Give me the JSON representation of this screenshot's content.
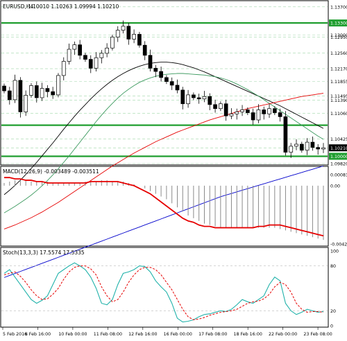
{
  "chart_data": [
    {
      "type": "candlestick",
      "title": "EURUSD,H4",
      "ohlc_readout": "1.10010 1.10263 1.09994 1.10210",
      "ylim": [
        1.0982,
        1.138
      ],
      "y_tick_labels": [
        "1.13700",
        "1.13300",
        "1.13000",
        "1.12950",
        "1.12560",
        "1.12170",
        "1.11855",
        "1.11495",
        "1.11390",
        "1.11060",
        "1.10425",
        "1.10210",
        "1.10000",
        "1.09820"
      ],
      "current_price": "1.10210",
      "horizontal_levels": [
        1.133,
        1.1077,
        1.1
      ],
      "close_values": [
        1.1162,
        1.114,
        1.1188,
        1.111,
        1.1151,
        1.1175,
        1.1145,
        1.1168,
        1.116,
        1.1152,
        1.12,
        1.1235,
        1.1265,
        1.1276,
        1.125,
        1.124,
        1.1218,
        1.1244,
        1.1255,
        1.1268,
        1.1295,
        1.1312,
        1.1322,
        1.129,
        1.1302,
        1.1275,
        1.125,
        1.1218,
        1.121,
        1.1195,
        1.1185,
        1.1176,
        1.1164,
        1.113,
        1.1152,
        1.1145,
        1.1142,
        1.1148,
        1.1128,
        1.1118,
        1.113,
        1.11,
        1.1105,
        1.111,
        1.1115,
        1.1108,
        1.109,
        1.1115,
        1.1105,
        1.1118,
        1.1108,
        1.1098,
        1.101,
        1.1025,
        1.103,
        1.1015,
        1.1035,
        1.1022,
        1.1018,
        1.1021
      ],
      "moving_averages": [
        {
          "color": "#000000",
          "values": [
            1.0905,
            1.0916,
            1.0928,
            1.0941,
            1.0955,
            1.097,
            1.0985,
            1.1001,
            1.1017,
            1.1033,
            1.105,
            1.1067,
            1.1083,
            1.1099,
            1.1114,
            1.1128,
            1.1142,
            1.1155,
            1.1167,
            1.1178,
            1.1188,
            1.1197,
            1.1205,
            1.1212,
            1.1218,
            1.1223,
            1.1227,
            1.123,
            1.1232,
            1.1233,
            1.1233,
            1.1232,
            1.123,
            1.1227,
            1.1223,
            1.1219,
            1.1214,
            1.1209,
            1.1203,
            1.1197,
            1.1191,
            1.1185,
            1.1179,
            1.1173,
            1.1167,
            1.1161,
            1.1155,
            1.1149,
            1.1143,
            1.1137,
            1.1131,
            1.1125,
            1.1118,
            1.1111,
            1.1104,
            1.1097,
            1.109,
            1.1083,
            1.1076,
            1.1069
          ]
        },
        {
          "color": "#3c9a5f",
          "values": [
            1.086,
            1.0868,
            1.0876,
            1.0885,
            1.0894,
            1.0904,
            1.0915,
            1.0927,
            1.094,
            1.0954,
            1.0969,
            1.0985,
            1.1001,
            1.1018,
            1.1035,
            1.1052,
            1.1069,
            1.1086,
            1.1102,
            1.1117,
            1.1131,
            1.1144,
            1.1156,
            1.1166,
            1.1175,
            1.1183,
            1.1189,
            1.1194,
            1.1198,
            1.1201,
            1.1203,
            1.1204,
            1.1205,
            1.1205,
            1.1204,
            1.1203,
            1.1202,
            1.1201,
            1.1199,
            1.1197,
            1.1194,
            1.119,
            1.1185,
            1.1179,
            1.1172,
            1.1165,
            1.1157,
            1.1149,
            1.114,
            1.1131,
            1.1122,
            1.1113,
            1.1104,
            1.1095,
            1.1086,
            1.1077,
            1.1068,
            1.1059,
            1.105,
            1.1042
          ]
        },
        {
          "color": "#e60000",
          "values": [
            1.082,
            1.0825,
            1.083,
            1.0836,
            1.0842,
            1.0848,
            1.0855,
            1.0862,
            1.087,
            1.0878,
            1.0886,
            1.0895,
            1.0904,
            1.0913,
            1.0922,
            1.0931,
            1.094,
            1.0949,
            1.0958,
            1.0967,
            1.0976,
            1.0984,
            1.0992,
            1.1,
            1.1008,
            1.1015,
            1.1022,
            1.1029,
            1.1036,
            1.1042,
            1.1048,
            1.1054,
            1.106,
            1.1065,
            1.107,
            1.1075,
            1.108,
            1.1085,
            1.109,
            1.1094,
            1.1098,
            1.1102,
            1.1106,
            1.111,
            1.1114,
            1.1118,
            1.1121,
            1.1124,
            1.1127,
            1.113,
            1.1133,
            1.1136,
            1.1139,
            1.1142,
            1.1145,
            1.1148,
            1.115,
            1.1152,
            1.1154,
            1.1156
          ]
        },
        {
          "color": "#0000cc",
          "values": [
            1.07,
            1.0705,
            1.071,
            1.0715,
            1.072,
            1.0725,
            1.073,
            1.0735,
            1.074,
            1.0745,
            1.075,
            1.0755,
            1.076,
            1.0765,
            1.077,
            1.0775,
            1.078,
            1.0785,
            1.079,
            1.0795,
            1.08,
            1.0805,
            1.081,
            1.0815,
            1.082,
            1.0825,
            1.083,
            1.0835,
            1.084,
            1.0845,
            1.085,
            1.0855,
            1.086,
            1.0865,
            1.087,
            1.0875,
            1.088,
            1.0885,
            1.089,
            1.0895,
            1.09,
            1.0904,
            1.0908,
            1.0912,
            1.0916,
            1.092,
            1.0924,
            1.0928,
            1.0932,
            1.0936,
            1.094,
            1.0944,
            1.0948,
            1.0952,
            1.0956,
            1.096,
            1.0964,
            1.0968,
            1.0972,
            1.0976
          ]
        }
      ]
    },
    {
      "type": "bar",
      "title": "MACD(12,26,9) -0.003489 -0.003511",
      "ylim": [
        -0.004299,
        0.000813
      ],
      "y_tick_labels": [
        "0.000813",
        "0.00",
        "-0.004299"
      ],
      "histogram_values": [
        0.0002,
        0.0003,
        0.0004,
        0.0004,
        0.0004,
        0.0003,
        0.0003,
        0.0003,
        0.0003,
        0.0002,
        0.0002,
        0.0002,
        0.0002,
        0.0002,
        0.0002,
        0.0003,
        0.0003,
        0.0003,
        0.0004,
        0.0004,
        0.0003,
        0.0003,
        0.0003,
        0.0002,
        0.0001,
        0.0,
        -0.0002,
        -0.0004,
        -0.0006,
        -0.0008,
        -0.001,
        -0.0013,
        -0.0016,
        -0.0019,
        -0.0022,
        -0.0024,
        -0.0026,
        -0.0028,
        -0.0029,
        -0.003,
        -0.0031,
        -0.0031,
        -0.0031,
        -0.0031,
        -0.0031,
        -0.0031,
        -0.0031,
        -0.0031,
        -0.0031,
        -0.0031,
        -0.0031,
        -0.0032,
        -0.0033,
        -0.0034,
        -0.0035,
        -0.0036,
        -0.0037,
        -0.0038,
        -0.0039,
        -0.004
      ],
      "signal_values": [
        0.0006,
        0.0006,
        0.0005,
        0.0005,
        0.0004,
        0.0004,
        0.0003,
        0.0003,
        0.0002,
        0.0002,
        0.0002,
        0.0002,
        0.0002,
        0.0002,
        0.0002,
        0.0002,
        0.0003,
        0.0003,
        0.0003,
        0.0003,
        0.0003,
        0.0003,
        0.0002,
        0.0001,
        0.0,
        -0.0002,
        -0.0004,
        -0.0006,
        -0.0009,
        -0.0012,
        -0.0015,
        -0.0018,
        -0.0021,
        -0.0024,
        -0.0026,
        -0.0027,
        -0.0029,
        -0.003,
        -0.003,
        -0.0031,
        -0.0031,
        -0.0031,
        -0.0031,
        -0.0031,
        -0.0031,
        -0.0031,
        -0.0031,
        -0.003,
        -0.003,
        -0.0029,
        -0.0029,
        -0.0029,
        -0.003,
        -0.0031,
        -0.0032,
        -0.0033,
        -0.0034,
        -0.0035,
        -0.0036,
        -0.0037
      ]
    },
    {
      "type": "line",
      "title": "Stoch(13,3,3) 17.5574 17.5335",
      "ylim": [
        0,
        100
      ],
      "y_tick_labels": [
        "100",
        "80",
        "20",
        "0"
      ],
      "levels": [
        80,
        20
      ],
      "main_values": [
        70,
        75,
        65,
        55,
        45,
        35,
        30,
        34,
        40,
        55,
        70,
        75,
        80,
        84,
        80,
        75,
        65,
        50,
        30,
        28,
        35,
        55,
        70,
        72,
        75,
        80,
        79,
        72,
        60,
        52,
        45,
        30,
        10,
        5,
        6,
        8,
        12,
        15,
        16,
        18,
        20,
        19,
        22,
        28,
        35,
        32,
        30,
        35,
        40,
        55,
        65,
        60,
        30,
        20,
        15,
        18,
        22,
        20,
        18,
        19
      ],
      "signal_values": [
        68,
        70,
        72,
        66,
        58,
        48,
        40,
        35,
        36,
        42,
        50,
        62,
        72,
        78,
        80,
        80,
        76,
        68,
        52,
        40,
        32,
        35,
        45,
        58,
        68,
        75,
        78,
        78,
        75,
        68,
        58,
        48,
        35,
        22,
        12,
        8,
        9,
        11,
        14,
        16,
        18,
        19,
        20,
        22,
        26,
        30,
        32,
        33,
        36,
        42,
        52,
        58,
        55,
        45,
        30,
        22,
        18,
        19,
        19,
        18
      ]
    }
  ],
  "x_tick_labels": [
    "5 Feb 2016",
    "8 Feb 16:00",
    "10 Feb 00:00",
    "11 Feb 08:00",
    "12 Feb 16:00",
    "16 Feb 00:00",
    "17 Feb 08:00",
    "18 Feb 16:00",
    "22 Feb 00:00",
    "23 Feb 08:00"
  ]
}
